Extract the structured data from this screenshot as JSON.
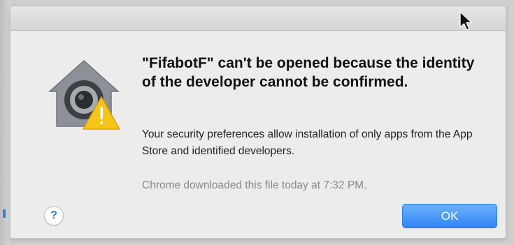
{
  "dialog": {
    "title": "\"FifabotF\" can't be opened because the identity of the developer cannot be confirmed.",
    "message": "Your security preferences allow installation of only apps from the App Store and identified developers.",
    "download_note": "Chrome downloaded this file today at 7:32 PM.",
    "help_label": "?",
    "ok_label": "OK",
    "icon": "gatekeeper-security-icon",
    "warning_badge": "warning-icon"
  },
  "colors": {
    "ok_button": "#2e86f5",
    "help_glyph": "#2a7ad6",
    "warning": "#f5c518"
  }
}
